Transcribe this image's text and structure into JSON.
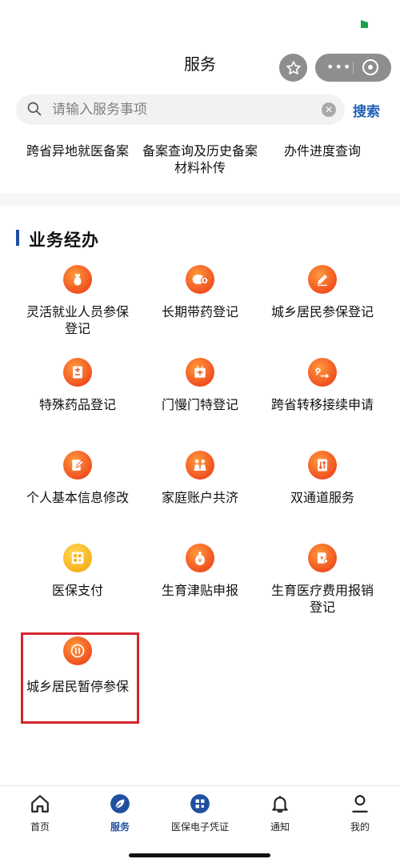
{
  "header": {
    "title": "服务"
  },
  "search": {
    "placeholder": "请输入服务事项",
    "button_label": "搜索"
  },
  "quick_links": [
    "跨省异地就医备案",
    "备案查询及历史备案材料补传",
    "办件进度查询"
  ],
  "section": {
    "title": "业务经办"
  },
  "services": [
    {
      "label": "灵活就业人员参保登记",
      "icon": "vase-icon"
    },
    {
      "label": "长期带药登记",
      "icon": "pill-icon"
    },
    {
      "label": "城乡居民参保登记",
      "icon": "pencil-icon"
    },
    {
      "label": "特殊药品登记",
      "icon": "medicine-box-icon"
    },
    {
      "label": "门慢门特登记",
      "icon": "calendar-icon"
    },
    {
      "label": "跨省转移接续申请",
      "icon": "route-icon"
    },
    {
      "label": "个人基本信息修改",
      "icon": "edit-document-icon"
    },
    {
      "label": "家庭账户共济",
      "icon": "family-icon"
    },
    {
      "label": "双通道服务",
      "icon": "dual-arrow-icon"
    },
    {
      "label": "医保支付",
      "icon": "qr-code-icon"
    },
    {
      "label": "生育津贴申报",
      "icon": "money-bag-icon"
    },
    {
      "label": "生育医疗费用报销登记",
      "icon": "receipt-icon"
    },
    {
      "label": "城乡居民暂停参保",
      "icon": "pause-icon"
    }
  ],
  "tabs": [
    {
      "label": "首页",
      "icon": "home-icon"
    },
    {
      "label": "服务",
      "icon": "leaf-icon"
    },
    {
      "label": "医保电子凭证",
      "icon": "qr-code-icon"
    },
    {
      "label": "通知",
      "icon": "bell-icon"
    },
    {
      "label": "我的",
      "icon": "person-icon"
    }
  ],
  "active_tab": "服务",
  "colors": {
    "accent": "#1f4fa0",
    "icon_orange": "#f0511f",
    "icon_yellow": "#f7b21a",
    "highlight": "#d6232f"
  }
}
